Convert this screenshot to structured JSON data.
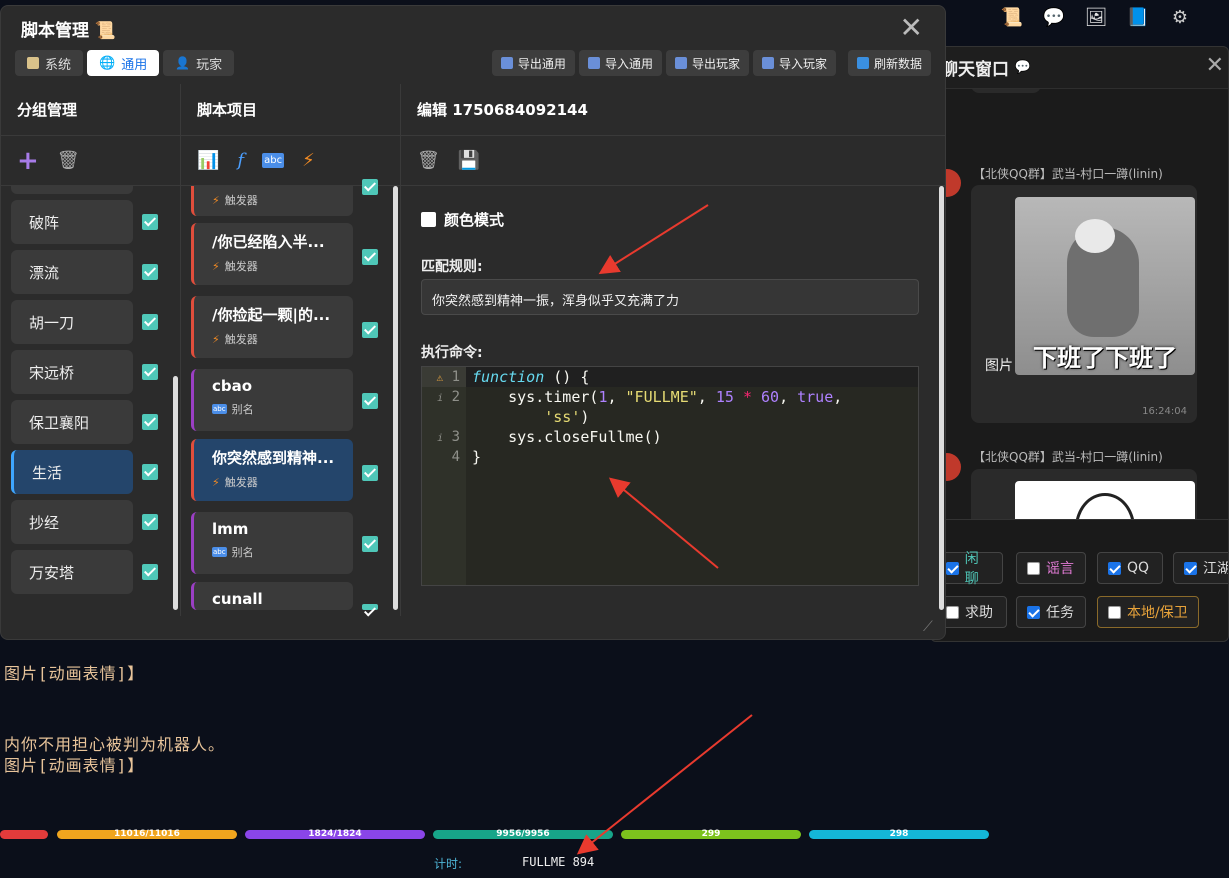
{
  "topbar": {
    "icons": [
      "scroll-icon",
      "chat-bubble-icon",
      "image-icon",
      "book-icon",
      "gear-icon"
    ]
  },
  "chat": {
    "title": "聊天窗口",
    "messages": [
      {
        "sender": "【北侠QQ群】武当-村口一蹲(linin)",
        "image_caption": "下班了下班了",
        "label": "图片",
        "time": "16:24:04"
      },
      {
        "sender": "【北侠QQ群】武当-村口一蹲(linin)"
      }
    ],
    "filters": [
      {
        "label": "闲聊",
        "checked": true,
        "color": "#4fc7b8"
      },
      {
        "label": "谣言",
        "checked": false,
        "color": "#e07ad4"
      },
      {
        "label": "QQ",
        "checked": true,
        "color": "#dddddd"
      },
      {
        "label": "江湖",
        "checked": true,
        "color": "#dddddd"
      },
      {
        "label": "求助",
        "checked": false,
        "color": "#dddddd"
      },
      {
        "label": "任务",
        "checked": true,
        "color": "#dddddd"
      },
      {
        "label": "本地/保卫",
        "checked": false,
        "color": "#e8a33a"
      }
    ]
  },
  "modal": {
    "title": "脚本管理",
    "tabs": [
      {
        "label": "系统"
      },
      {
        "label": "通用",
        "active": true
      },
      {
        "label": "玩家"
      }
    ],
    "toolbar": [
      "导出通用",
      "导入通用",
      "导出玩家",
      "导入玩家",
      "刷新数据"
    ],
    "columns": {
      "groups": "分组管理",
      "items": "脚本项目",
      "editor": "编辑 1750684092144"
    },
    "groups": [
      "破阵",
      "漂流",
      "胡一刀",
      "宋远桥",
      "保卫襄阳",
      "生活",
      "抄经",
      "万安塔"
    ],
    "active_group": "生活",
    "items": [
      {
        "title": "",
        "type": "触发器",
        "kind": "trig"
      },
      {
        "title": "/你已经陷入半...",
        "type": "触发器",
        "kind": "trig"
      },
      {
        "title": "/你捡起一颗|的...",
        "type": "触发器",
        "kind": "trig"
      },
      {
        "title": "cbao",
        "type": "别名",
        "kind": "alias"
      },
      {
        "title": "你突然感到精神...",
        "type": "触发器",
        "kind": "trig",
        "active": true
      },
      {
        "title": "lmm",
        "type": "别名",
        "kind": "alias"
      },
      {
        "title": "cunall",
        "type": "",
        "kind": "alias"
      }
    ],
    "editor": {
      "color_mode": "颜色模式",
      "match_label": "匹配规则:",
      "match_value": "你突然感到精神一振，浑身似乎又充满了力",
      "command_label": "执行命令:",
      "code_lines": [
        "1",
        "2",
        "3",
        "4"
      ]
    }
  },
  "log": {
    "lines": [
      "图片[动画表情]】",
      "内你不用担心被判为机器人。",
      "图片[动画表情]】"
    ]
  },
  "status_bars": [
    {
      "text": "",
      "color": "#e23b3b"
    },
    {
      "text": "11016/11016",
      "color": "#f0a51e"
    },
    {
      "text": "1824/1824",
      "color": "#8a45e8"
    },
    {
      "text": "9956/9956",
      "color": "#17a589"
    },
    {
      "text": "299",
      "color": "#7cc21d"
    },
    {
      "text": "298",
      "color": "#14b6d8"
    }
  ],
  "status": {
    "label": "计时:",
    "value": "FULLME 894"
  }
}
